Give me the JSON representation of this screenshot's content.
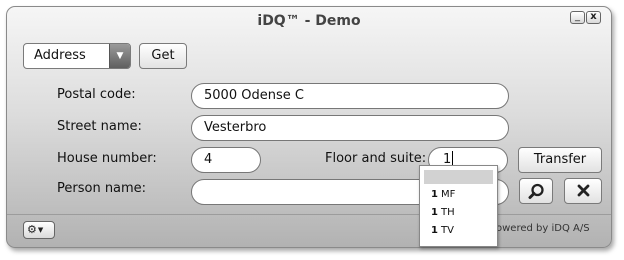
{
  "window": {
    "title": "iDQ™ - Demo",
    "minimize_glyph": "_",
    "close_glyph": "x"
  },
  "toolbar": {
    "type_select_value": "Address",
    "get_label": "Get"
  },
  "form": {
    "postal_label": "Postal code:",
    "postal_value": "5000 Odense C",
    "street_label": "Street name:",
    "street_value": "Vesterbro",
    "house_label": "House number:",
    "house_value": "4",
    "floor_label": "Floor and suite:",
    "floor_value": "1",
    "person_label": "Person name:",
    "person_value": "",
    "transfer_label": "Transfer"
  },
  "dropdown": {
    "options": [
      {
        "bold": "1",
        "rest": "MF"
      },
      {
        "bold": "1",
        "rest": "TH"
      },
      {
        "bold": "1",
        "rest": "TV"
      }
    ]
  },
  "footer": {
    "powered_text": "owered by iDQ A/S"
  },
  "icons": {
    "search": "magnifier-icon",
    "clear": "x-icon",
    "settings": "gear-icon"
  }
}
